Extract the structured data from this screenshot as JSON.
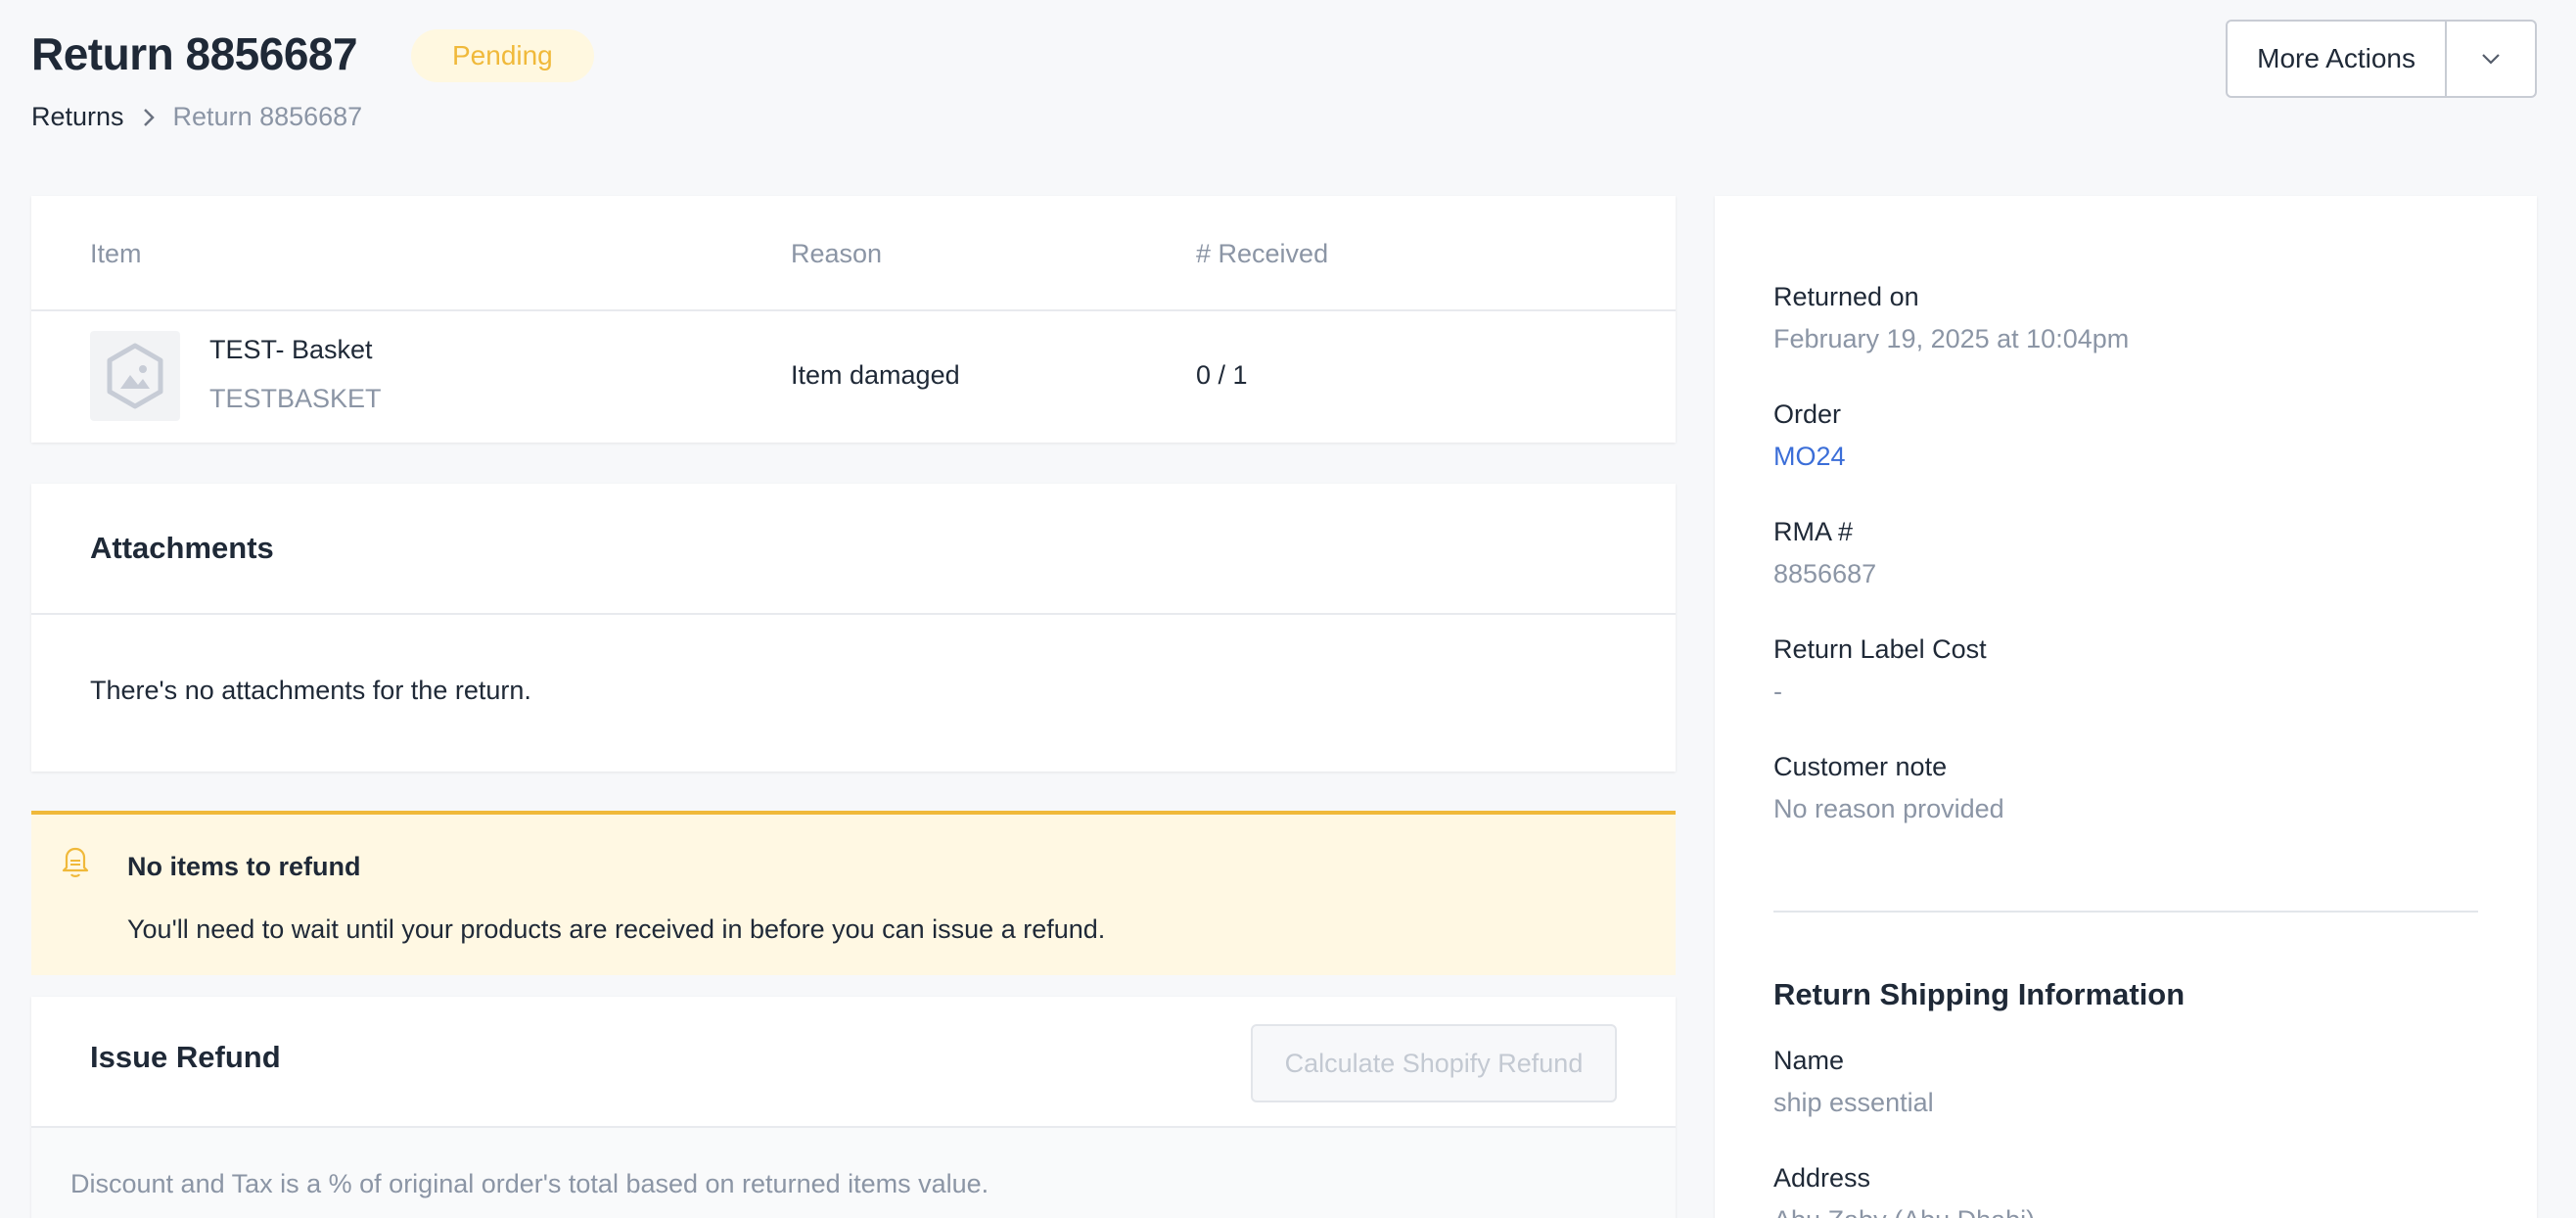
{
  "header": {
    "title": "Return 8856687",
    "status": "Pending",
    "breadcrumb": {
      "root": "Returns",
      "current": "Return 8856687"
    },
    "more_actions_label": "More Actions"
  },
  "items_table": {
    "columns": {
      "item": "Item",
      "reason": "Reason",
      "received": "# Received"
    },
    "rows": [
      {
        "name": "TEST- Basket",
        "sku": "TESTBASKET",
        "reason": "Item damaged",
        "received": "0 / 1"
      }
    ]
  },
  "attachments": {
    "title": "Attachments",
    "empty_text": "There's no attachments for the return."
  },
  "alert": {
    "title": "No items to refund",
    "message": "You'll need to wait until your products are received in before you can issue a refund."
  },
  "refund": {
    "title": "Issue Refund",
    "calculate_label": "Calculate Shopify Refund",
    "note": "Discount and Tax is a % of original order's total based on returned items value."
  },
  "details": {
    "returned_on": {
      "label": "Returned on",
      "value": "February 19, 2025 at 10:04pm"
    },
    "order": {
      "label": "Order",
      "value": "MO24"
    },
    "rma": {
      "label": "RMA #",
      "value": "8856687"
    },
    "label_cost": {
      "label": "Return Label Cost",
      "value": "-"
    },
    "customer_note": {
      "label": "Customer note",
      "value": "No reason provided"
    }
  },
  "shipping": {
    "title": "Return Shipping Information",
    "name": {
      "label": "Name",
      "value": "ship essential"
    },
    "address": {
      "label": "Address",
      "value": "Abu Zaby (Abu Dhabi)"
    }
  },
  "colors": {
    "status_bg": "#fff8e0",
    "status_text": "#f0b93a",
    "link": "#3b6ed8",
    "alert_bg": "#fff8e3",
    "alert_border": "#f0b93a"
  }
}
